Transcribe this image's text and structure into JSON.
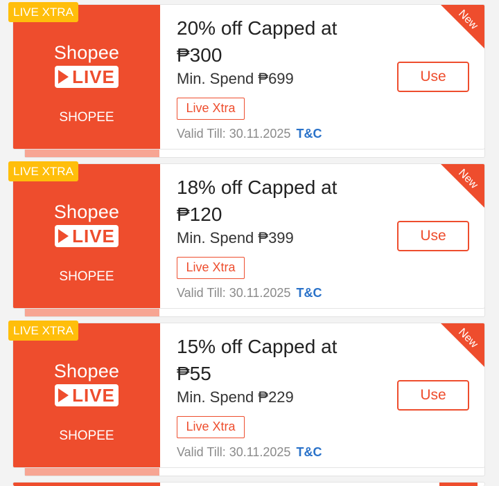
{
  "vouchers": [
    {
      "badge": "LIVE XTRA",
      "logo_word": "Shopee",
      "live_word": "LIVE",
      "shop_name": "SHOPEE",
      "title_line1": "20% off Capped at",
      "title_line2": "₱300",
      "min_spend": "Min. Spend ₱699",
      "tag": "Live Xtra",
      "valid": "Valid Till: 30.11.2025",
      "tnc": "T&C",
      "use_label": "Use",
      "corner": "New"
    },
    {
      "badge": "LIVE XTRA",
      "logo_word": "Shopee",
      "live_word": "LIVE",
      "shop_name": "SHOPEE",
      "title_line1": "18% off Capped at",
      "title_line2": "₱120",
      "min_spend": "Min. Spend ₱399",
      "tag": "Live Xtra",
      "valid": "Valid Till: 30.11.2025",
      "tnc": "T&C",
      "use_label": "Use",
      "corner": "New"
    },
    {
      "badge": "LIVE XTRA",
      "logo_word": "Shopee",
      "live_word": "LIVE",
      "shop_name": "SHOPEE",
      "title_line1": "15% off Capped at",
      "title_line2": "₱55",
      "min_spend": "Min. Spend ₱229",
      "tag": "Live Xtra",
      "valid": "Valid Till: 30.11.2025",
      "tnc": "T&C",
      "use_label": "Use",
      "corner": "New"
    }
  ],
  "colors": {
    "brand": "#ee4d2d",
    "badge": "#ffbe0b",
    "link": "#2a72c9"
  }
}
